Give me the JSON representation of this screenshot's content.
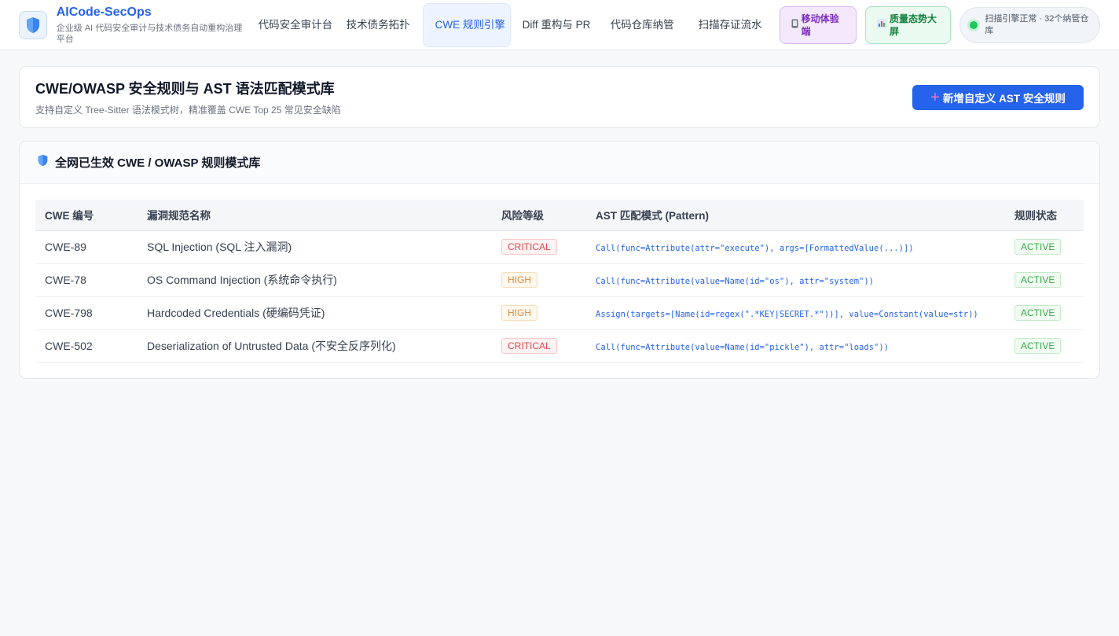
{
  "app": {
    "title": "AICode-SecOps",
    "subtitle": "企业级 AI 代码安全审计与技术债务自动重构治理平台"
  },
  "nav": {
    "items": [
      {
        "label": "代码安全审计台"
      },
      {
        "label": "技术债务拓扑"
      },
      {
        "label": "CWE 规则引擎"
      },
      {
        "label": "Diff 重构与 PR"
      },
      {
        "label": "代码仓库纳管"
      },
      {
        "label": "扫描存证流水"
      }
    ],
    "mobile_label": "移动体验端",
    "mobile_icon": "phone-icon",
    "dashboard_label": "质量态势大屏",
    "dashboard_icon": "bar-chart-icon"
  },
  "status": {
    "text": "扫描引擎正常 · 32个纳管仓库",
    "color": "#22c55e"
  },
  "page": {
    "title": "CWE/OWASP 安全规则与 AST 语法匹配模式库",
    "subtitle": "支持自定义 Tree-Sitter 语法模式树，精准覆盖 CWE Top 25 常见安全缺陷",
    "add_button": "新增自定义 AST 安全规则"
  },
  "rules_section": {
    "title": "全网已生效 CWE / OWASP 规则模式库",
    "columns": [
      "CWE 编号",
      "漏洞规范名称",
      "风险等级",
      "AST 匹配模式 (Pattern)",
      "规则状态"
    ],
    "rows": [
      {
        "id": "CWE-89",
        "name": "SQL Injection (SQL 注入漏洞)",
        "level": "CRITICAL",
        "pattern": "Call(func=Attribute(attr=\"execute\"), args=[FormattedValue(...)])",
        "status": "ACTIVE"
      },
      {
        "id": "CWE-78",
        "name": "OS Command Injection (系统命令执行)",
        "level": "HIGH",
        "pattern": "Call(func=Attribute(value=Name(id=\"os\"), attr=\"system\"))",
        "status": "ACTIVE"
      },
      {
        "id": "CWE-798",
        "name": "Hardcoded Credentials (硬编码凭证)",
        "level": "HIGH",
        "pattern": "Assign(targets=[Name(id=regex(\".*KEY|SECRET.*\"))], value=Constant(value=str))",
        "status": "ACTIVE"
      },
      {
        "id": "CWE-502",
        "name": "Deserialization of Untrusted Data (不安全反序列化)",
        "level": "CRITICAL",
        "pattern": "Call(func=Attribute(value=Name(id=\"pickle\"), attr=\"loads\"))",
        "status": "ACTIVE"
      }
    ]
  },
  "colors": {
    "brand": "#2563eb",
    "critical": "#e5484d",
    "high": "#e08a3b",
    "active": "#3da84a"
  }
}
